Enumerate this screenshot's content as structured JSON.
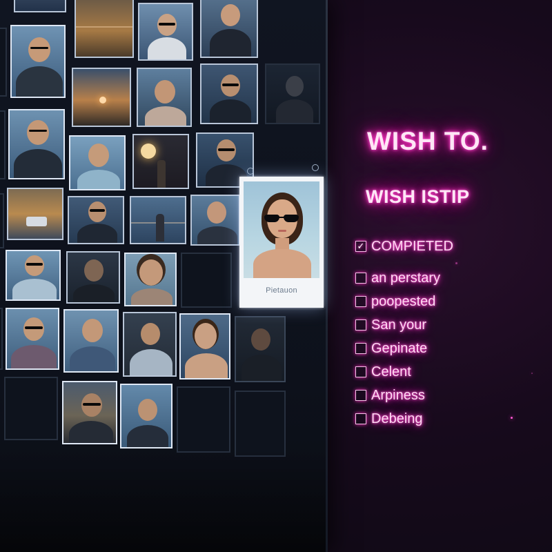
{
  "wish_panel": {
    "title": "WISH TO.",
    "subtitle": "WISH ISTIP",
    "items": [
      {
        "label": "COMPIETED",
        "checked": true
      },
      {
        "label": "an perstary",
        "checked": false
      },
      {
        "label": "poopested",
        "checked": false
      },
      {
        "label": "San your",
        "checked": false
      },
      {
        "label": "Gepinate",
        "checked": false
      },
      {
        "label": "Celent",
        "checked": false
      },
      {
        "label": "Arpiness",
        "checked": false
      },
      {
        "label": "Debeing",
        "checked": false
      }
    ]
  },
  "featured_photo": {
    "caption": "Pietauon"
  },
  "colors": {
    "neon_pink": "#ff2cc0",
    "wall": "#101521",
    "tile_border": "#b9c6d8"
  },
  "icons": {
    "checkbox_checked": "checkbox-checked-icon",
    "checkbox_empty": "checkbox-icon",
    "pin": "pin-icon"
  }
}
